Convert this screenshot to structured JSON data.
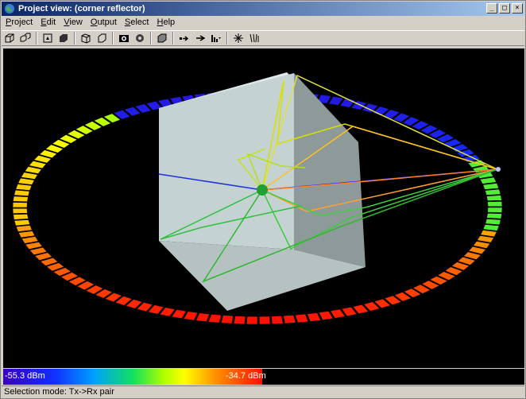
{
  "window": {
    "title": "Project view: (corner reflector)"
  },
  "menu": {
    "items": [
      {
        "key": "P",
        "rest": "roject"
      },
      {
        "key": "E",
        "rest": "dit"
      },
      {
        "key": "V",
        "rest": "iew"
      },
      {
        "key": "O",
        "rest": "utput"
      },
      {
        "key": "S",
        "rest": "elect"
      },
      {
        "key": "H",
        "rest": "elp"
      }
    ]
  },
  "legend": {
    "min_label": "-55.3 dBm",
    "max_label": "-34.7 dBm"
  },
  "status": {
    "text": "Selection mode: Tx->Rx pair"
  },
  "colors": {
    "title_start": "#0a246a",
    "title_end": "#a6caf0",
    "viewport_bg": "#000000",
    "cube": "#c8d6d6"
  }
}
